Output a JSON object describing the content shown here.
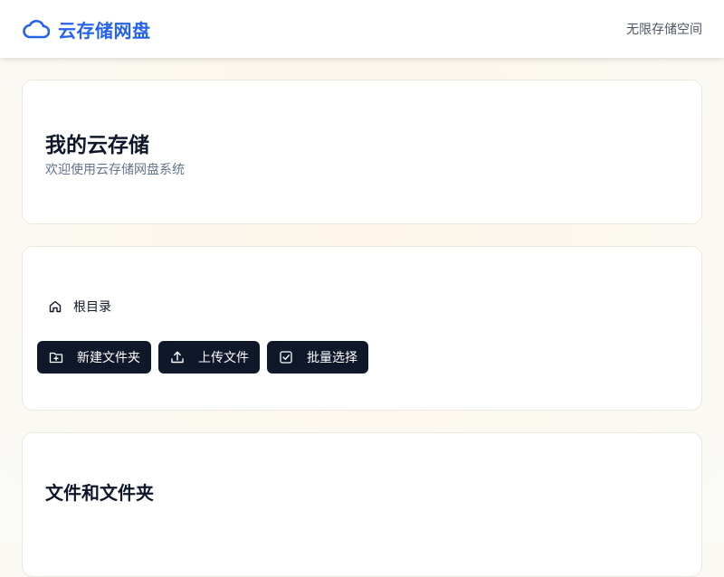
{
  "header": {
    "brand_icon": "cloud-icon",
    "title": "云存储网盘",
    "tagline": "无限存储空间",
    "brand_color": "#2563eb"
  },
  "hero": {
    "title": "我的云存储",
    "subtitle": "欢迎使用云存储网盘系统"
  },
  "breadcrumb": {
    "icon": "home-icon",
    "root_label": "根目录"
  },
  "toolbar": {
    "buttons": [
      {
        "icon": "folder-plus-icon",
        "label": "新建文件夹"
      },
      {
        "icon": "upload-icon",
        "label": "上传文件"
      },
      {
        "icon": "checkbox-icon",
        "label": "批量选择"
      }
    ],
    "button_color": "#0f172a"
  },
  "files": {
    "title": "文件和文件夹"
  }
}
